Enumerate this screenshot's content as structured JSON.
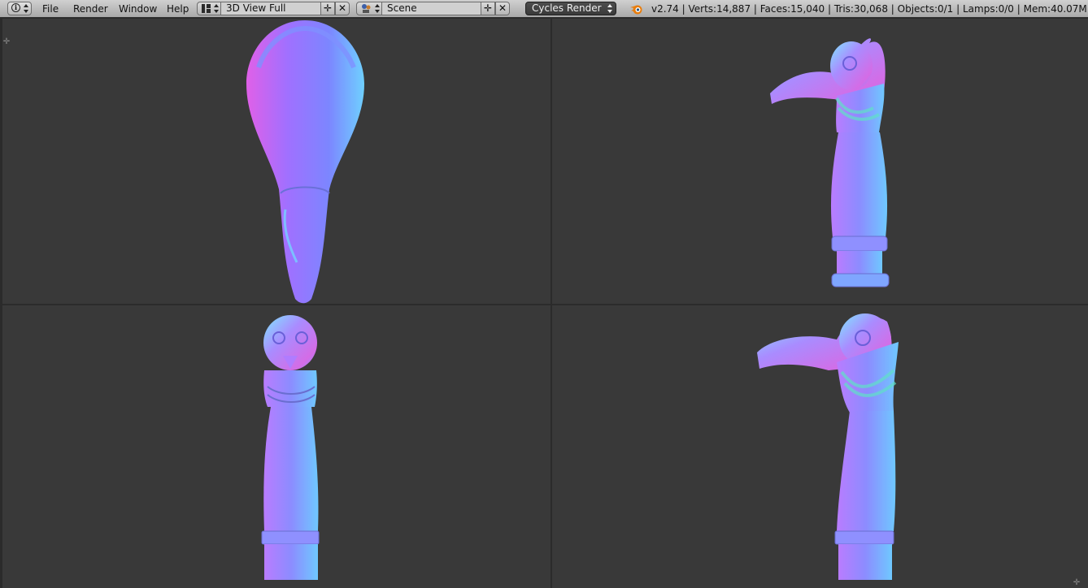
{
  "header": {
    "menus": [
      "File",
      "Render",
      "Window",
      "Help"
    ],
    "screen_layout": "3D View Full",
    "scene": "Scene",
    "render_engine": "Cycles Render",
    "stats": "v2.74 | Verts:14,887 | Faces:15,040 | Tris:30,068 | Objects:0/1 | Lamps:0/0 | Mem:40.07M | logo",
    "icons": {
      "editor": "info-icon",
      "layout": "screen-layout-icon",
      "scene": "scene-icon",
      "add": "add-icon",
      "remove": "remove-icon",
      "blender": "blender-logo-icon"
    }
  },
  "viewports": [
    {
      "name": "top",
      "view": "top"
    },
    {
      "name": "right",
      "view": "side-right"
    },
    {
      "name": "front",
      "view": "front"
    },
    {
      "name": "side",
      "view": "side-left"
    }
  ],
  "colors": {
    "header": "#bcbcbc",
    "viewport_bg": "#393939",
    "engine_bg": "#444444",
    "mesh_blue": "#7f8fff",
    "mesh_magenta": "#d85ae0",
    "mesh_cyan": "#66d9ff"
  }
}
